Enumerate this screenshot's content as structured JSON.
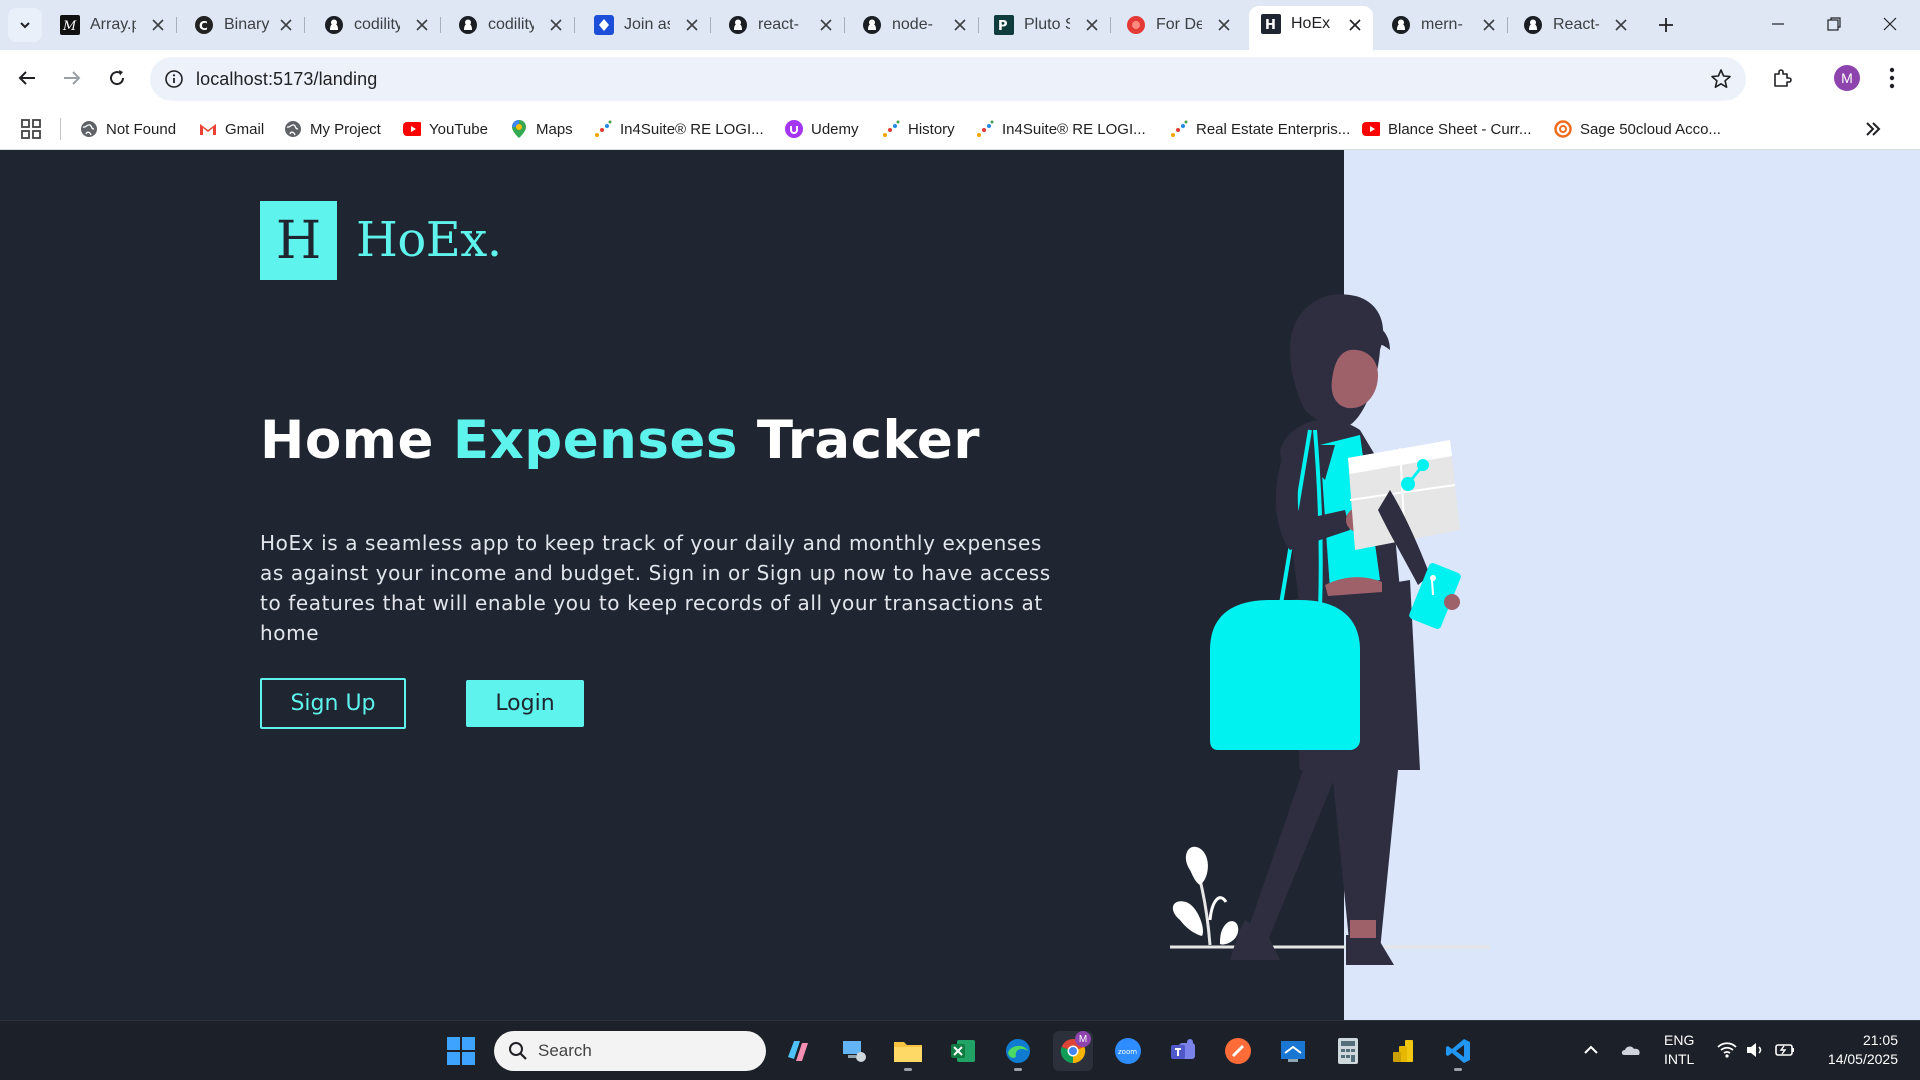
{
  "tabs": [
    {
      "title": "Array.p"
    },
    {
      "title": "Binary"
    },
    {
      "title": "codility"
    },
    {
      "title": "codility"
    },
    {
      "title": "Join as"
    },
    {
      "title": "react-"
    },
    {
      "title": "node-"
    },
    {
      "title": "Pluto S"
    },
    {
      "title": "For De"
    },
    {
      "title": "HoEx"
    },
    {
      "title": "mern-"
    },
    {
      "title": "React-"
    }
  ],
  "toolbar": {
    "url": "localhost:5173/landing",
    "profile_initial": "M"
  },
  "bookmarks": [
    {
      "label": "Not Found",
      "icon": "globe-icon"
    },
    {
      "label": "Gmail",
      "icon": "gmail-icon"
    },
    {
      "label": "My Project",
      "icon": "globe-icon"
    },
    {
      "label": "YouTube",
      "icon": "youtube-icon"
    },
    {
      "label": "Maps",
      "icon": "maps-icon"
    },
    {
      "label": "In4Suite® RE LOGI...",
      "icon": "in4suite-icon"
    },
    {
      "label": "Udemy",
      "icon": "udemy-icon"
    },
    {
      "label": "History",
      "icon": "in4suite-icon"
    },
    {
      "label": "In4Suite® RE LOGI...",
      "icon": "in4suite-icon"
    },
    {
      "label": "Real Estate Enterpris...",
      "icon": "in4suite-icon"
    },
    {
      "label": "Blance Sheet - Curr...",
      "icon": "youtube-icon"
    },
    {
      "label": "Sage 50cloud Acco...",
      "icon": "sage-icon"
    }
  ],
  "page": {
    "logo_letter": "H",
    "logo_text": "HoEx.",
    "title_part1": "Home ",
    "title_accent": "Expenses",
    "title_part2": " Tracker",
    "description": "HoEx is a seamless app to keep track of your daily and monthly expenses as against your income and budget. Sign in or Sign up now to have access to features that will enable you to keep records of all your transactions at home",
    "signup_label": "Sign Up",
    "login_label": "Login"
  },
  "taskbar": {
    "search_placeholder": "Search",
    "lang_line1": "ENG",
    "lang_line2": "INTL",
    "time": "21:05",
    "date": "14/05/2025",
    "chrome_badge": "M",
    "zoom_label": "zoom"
  },
  "colors": {
    "accent": "#5ef3ec",
    "page_bg": "#202631",
    "panel_bg": "#dbe6fb"
  }
}
